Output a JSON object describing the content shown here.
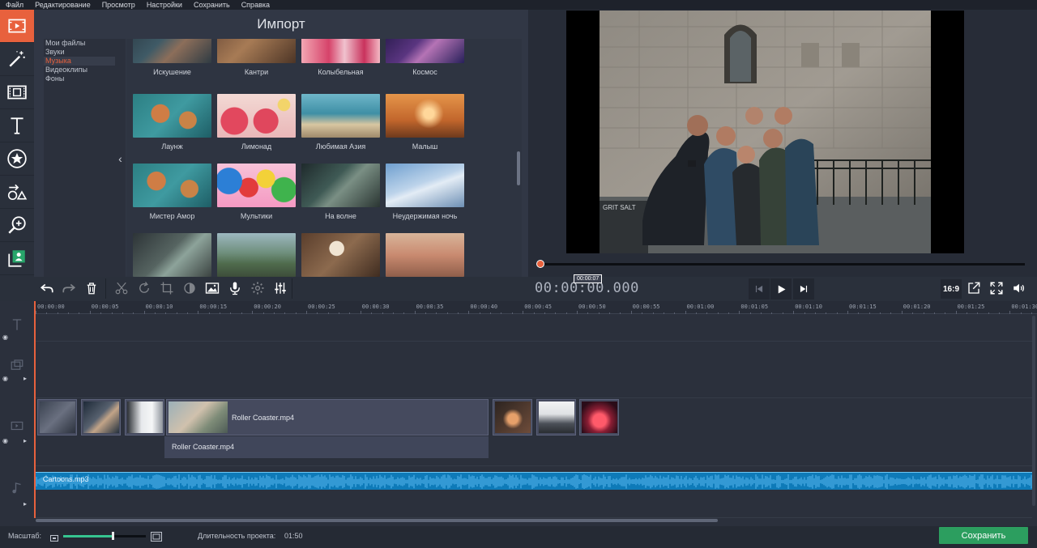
{
  "menu": [
    "Файл",
    "Редактирование",
    "Просмотр",
    "Настройки",
    "Сохранить",
    "Справка"
  ],
  "import": {
    "title": "Импорт",
    "categories": [
      "Мои файлы",
      "Звуки",
      "Музыка",
      "Видеоклипы",
      "Фоны"
    ],
    "selected_category": "Музыка",
    "tracks": [
      "Искушение",
      "Кантри",
      "Колыбельная",
      "Космос",
      "Лаунж",
      "Лимонад",
      "Любимая Азия",
      "Малыш",
      "Мистер Амор",
      "Мультики",
      "На волне",
      "Неудержимая ночь"
    ]
  },
  "preview": {
    "timecode": "00:00:00.000",
    "time_tooltip": "00:00:07",
    "aspect_ratio": "16:9",
    "position": 0.0
  },
  "timeline": {
    "ruler": [
      "00:00:00",
      "00:00:05",
      "00:00:10",
      "00:00:15",
      "00:00:20",
      "00:00:25",
      "00:00:30",
      "00:00:35",
      "00:00:40",
      "00:00:45",
      "00:00:50",
      "00:00:55",
      "00:01:00",
      "00:01:05",
      "00:01:10",
      "00:01:15",
      "00:01:20",
      "00:01:25",
      "00:01:30"
    ],
    "video_clip_name": "Roller Coaster.mp4",
    "video_audio_name": "Roller Coaster.mp4",
    "audio_clip_name": "Cartoons.mp3"
  },
  "status": {
    "scale_label": "Масштаб:",
    "duration_label": "Длительность проекта:",
    "duration_value": "01:50",
    "zoom_level": 0.6
  },
  "save_button": "Сохранить",
  "colors": {
    "accent": "#e8613d",
    "save": "#2c9e5f",
    "audio": "#0e7ab8"
  },
  "icons": {
    "tools": [
      "film-import-icon",
      "magic-wand-icon",
      "filmstrip-icon",
      "text-icon",
      "star-sticker-icon",
      "shapes-icon",
      "zoom-icon",
      "chroma-key-icon"
    ],
    "toolbar": [
      "undo-icon",
      "redo-icon",
      "trash-icon",
      "scissors-icon",
      "rotate-icon",
      "crop-icon",
      "color-icon",
      "picture-icon",
      "microphone-icon",
      "gear-icon",
      "equalizer-icon"
    ]
  }
}
